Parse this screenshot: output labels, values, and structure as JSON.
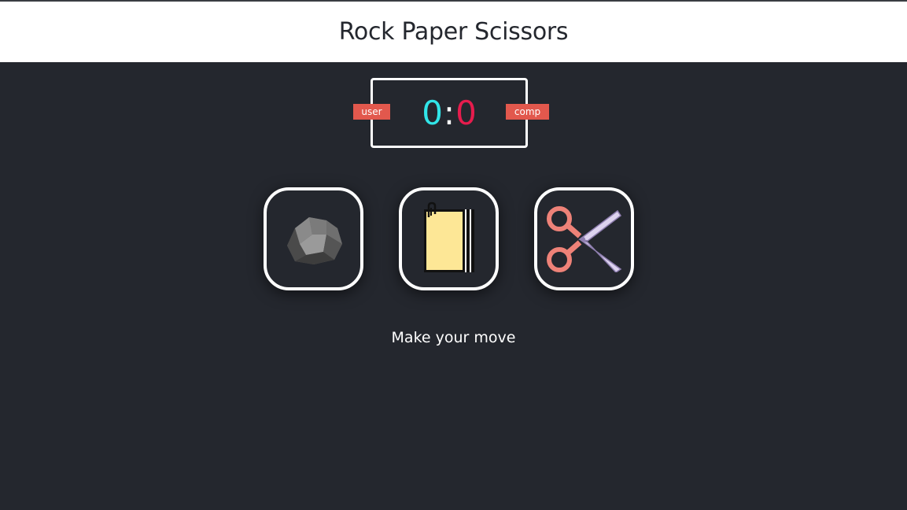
{
  "header": {
    "title": "Rock Paper Scissors"
  },
  "scoreboard": {
    "user_label": "user",
    "comp_label": "comp",
    "user_score": "0",
    "separator": ":",
    "comp_score": "0"
  },
  "choices": [
    {
      "name": "rock",
      "icon": "rock-icon"
    },
    {
      "name": "paper",
      "icon": "paper-icon"
    },
    {
      "name": "scissors",
      "icon": "scissors-icon"
    }
  ],
  "message": "Make your move",
  "colors": {
    "background": "#24272e",
    "header_bg": "#ffffff",
    "badge": "#e2584d",
    "user_score": "#31e5e8",
    "comp_score": "#e61c4d"
  }
}
